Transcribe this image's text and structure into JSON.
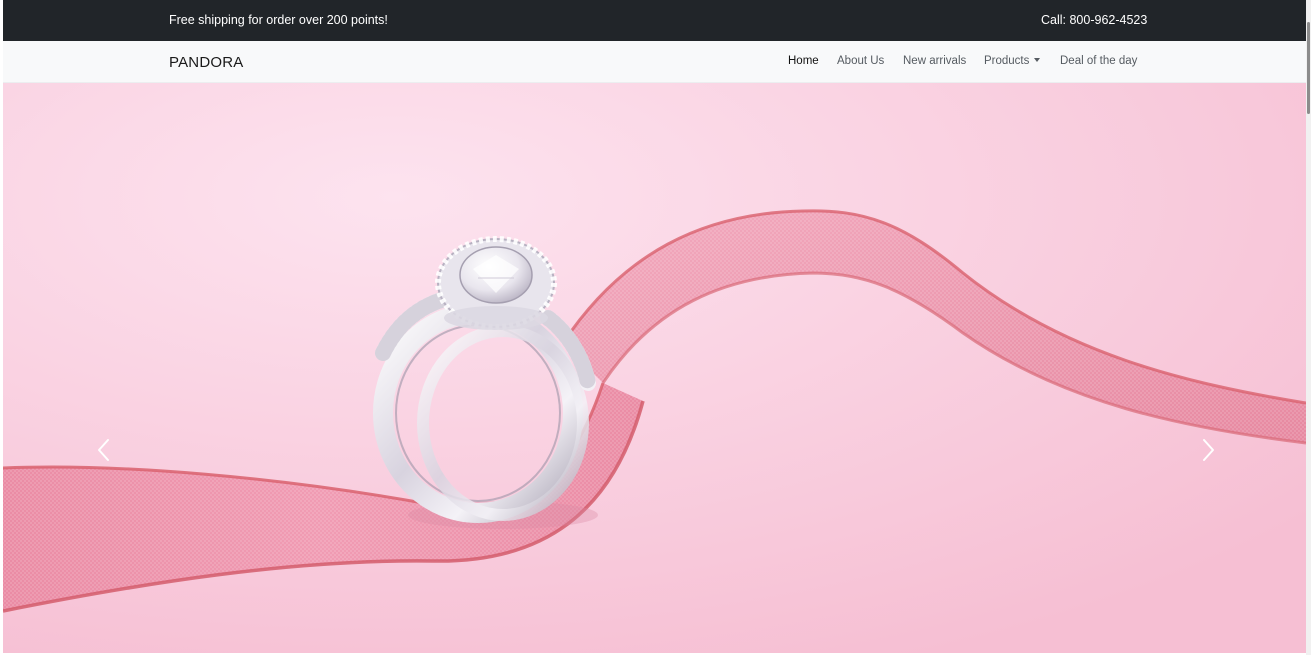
{
  "topbar": {
    "shipping_text": "Free shipping for order over 200 points!",
    "phone_text": "Call: 800-962-4523"
  },
  "navbar": {
    "brand": "PANDORA",
    "items": [
      {
        "label": "Home",
        "active": true
      },
      {
        "label": "About Us"
      },
      {
        "label": "New arrivals"
      },
      {
        "label": "Products",
        "dropdown": true
      },
      {
        "label": "Deal of the day"
      }
    ]
  },
  "carousel": {
    "slide_image": "diamond ring on pink ribbon",
    "prev_icon": "chevron-left-icon",
    "next_icon": "chevron-right-icon"
  },
  "colors": {
    "topbar_bg": "#212529",
    "navbar_bg": "#f8f9fa",
    "hero_pink": "#f8c9dc",
    "ribbon": "#e8869b",
    "ribbon_edge": "#d9616e"
  }
}
